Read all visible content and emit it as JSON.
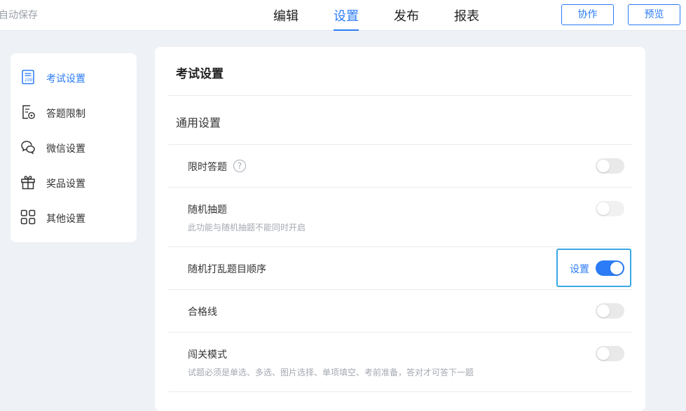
{
  "header": {
    "autosave_text": "自动保存",
    "tabs": [
      {
        "label": "编辑",
        "active": false
      },
      {
        "label": "设置",
        "active": true
      },
      {
        "label": "发布",
        "active": false
      },
      {
        "label": "报表",
        "active": false
      }
    ],
    "buttons": {
      "collaborate": "协作",
      "preview": "预览"
    }
  },
  "sidebar": {
    "items": [
      {
        "label": "考试设置",
        "icon": "exam-doc-icon",
        "active": true
      },
      {
        "label": "答题限制",
        "icon": "answer-limit-icon",
        "active": false
      },
      {
        "label": "微信设置",
        "icon": "wechat-icon",
        "active": false
      },
      {
        "label": "奖品设置",
        "icon": "gift-icon",
        "active": false
      },
      {
        "label": "其他设置",
        "icon": "grid-icon",
        "active": false
      }
    ]
  },
  "main": {
    "title": "考试设置",
    "section_title": "通用设置",
    "rows": [
      {
        "label": "限时答题",
        "has_help": true,
        "toggle_on": false
      },
      {
        "label": "随机抽题",
        "description": "此功能与随机抽题不能同时开启",
        "toggle_on": false,
        "disabled": true
      },
      {
        "label": "随机打乱题目顺序",
        "set_link": "设置",
        "toggle_on": true
      },
      {
        "label": "合格线",
        "toggle_on": false
      },
      {
        "label": "闯关模式",
        "description": "试题必须是单选、多选、图片选择、单项填空、考前准备，答对才可答下一题",
        "toggle_on": false
      }
    ],
    "help_glyph": "?"
  },
  "colors": {
    "accent": "#2b7cf6",
    "highlight_border": "#39a8e6",
    "page_bg": "#eef1f6"
  }
}
